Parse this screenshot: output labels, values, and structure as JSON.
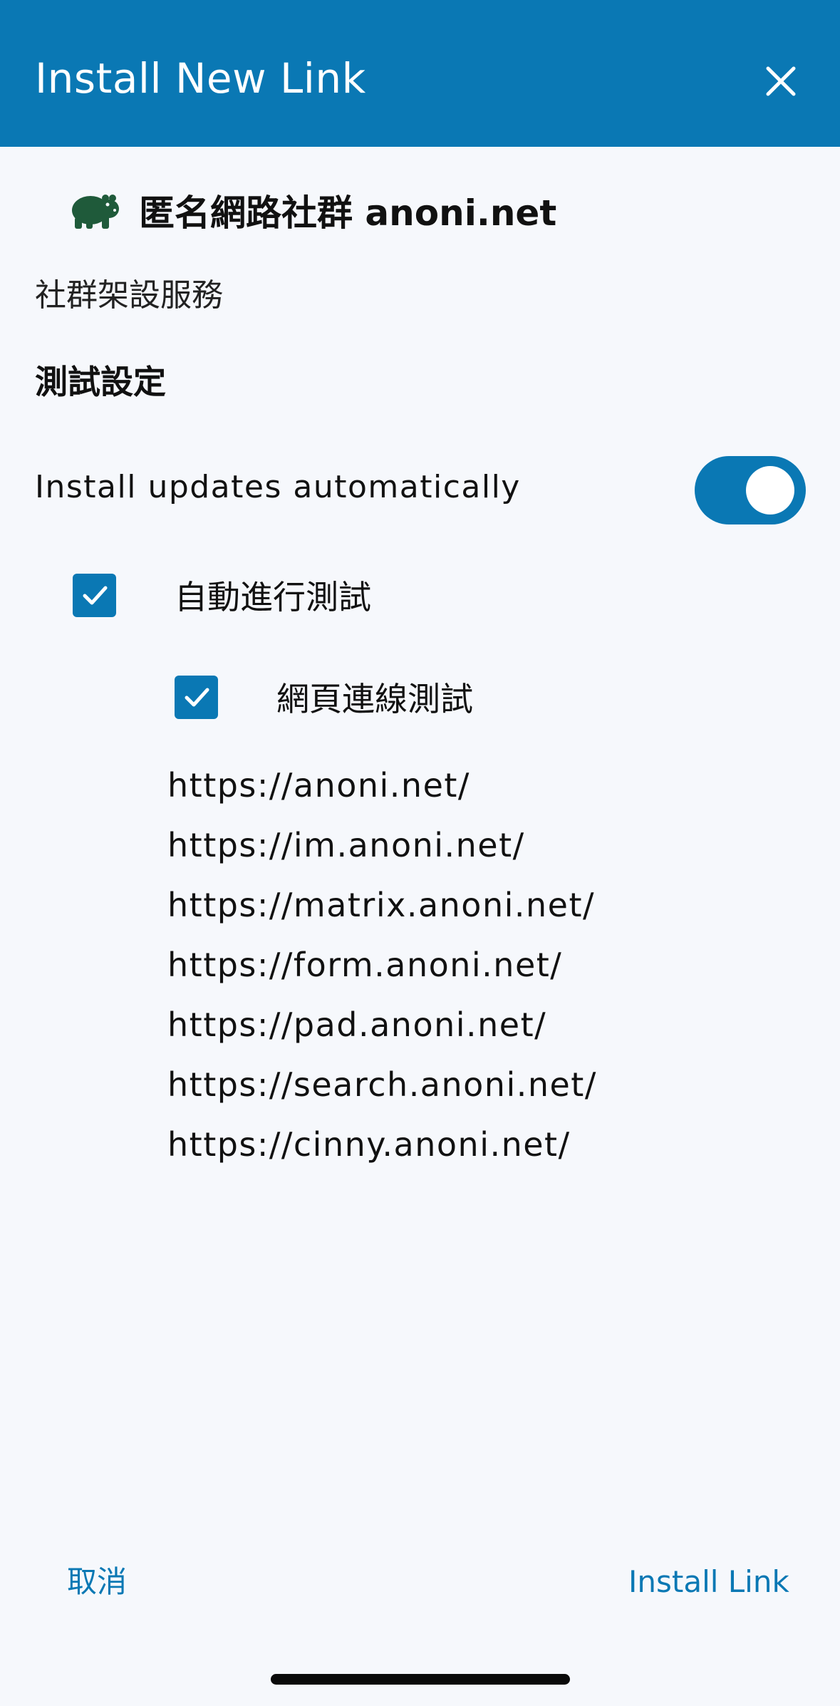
{
  "header": {
    "title": "Install New Link",
    "close_icon": "close-icon",
    "background": "#0a78b4"
  },
  "app": {
    "icon": "hippo-icon",
    "icon_color": "#1f5a3a",
    "name": "匿名網路社群 anoni.net"
  },
  "subtitle": "社群架設服務",
  "section_title": "測試設定",
  "auto_update": {
    "label": "Install updates automatically",
    "enabled": true
  },
  "options": [
    {
      "label": "自動進行測試",
      "checked": true
    },
    {
      "label": "網頁連線測試",
      "checked": true
    }
  ],
  "urls": [
    "https://anoni.net/",
    "https://im.anoni.net/",
    "https://matrix.anoni.net/",
    "https://form.anoni.net/",
    "https://pad.anoni.net/",
    "https://search.anoni.net/",
    "https://cinny.anoni.net/"
  ],
  "footer": {
    "cancel_label": "取消",
    "install_label": "Install Link"
  },
  "accent_color": "#0a78b4"
}
